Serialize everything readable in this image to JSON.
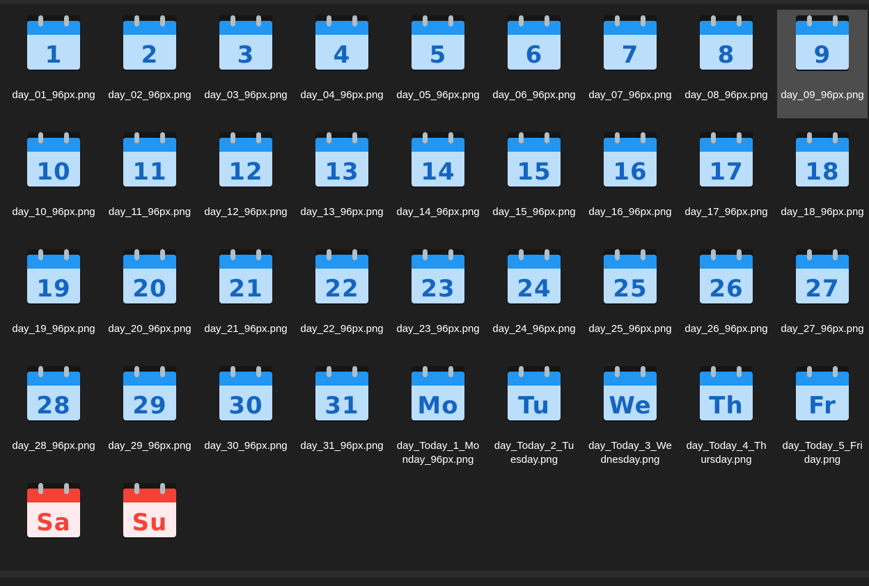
{
  "files": [
    {
      "day": "1",
      "name": "day_01_96px.png",
      "selected": false,
      "color": "blue"
    },
    {
      "day": "2",
      "name": "day_02_96px.png",
      "selected": false,
      "color": "blue"
    },
    {
      "day": "3",
      "name": "day_03_96px.png",
      "selected": false,
      "color": "blue"
    },
    {
      "day": "4",
      "name": "day_04_96px.png",
      "selected": false,
      "color": "blue"
    },
    {
      "day": "5",
      "name": "day_05_96px.png",
      "selected": false,
      "color": "blue"
    },
    {
      "day": "6",
      "name": "day_06_96px.png",
      "selected": false,
      "color": "blue"
    },
    {
      "day": "7",
      "name": "day_07_96px.png",
      "selected": false,
      "color": "blue"
    },
    {
      "day": "8",
      "name": "day_08_96px.png",
      "selected": false,
      "color": "blue"
    },
    {
      "day": "9",
      "name": "day_09_96px.png",
      "selected": true,
      "color": "blue"
    },
    {
      "day": "10",
      "name": "day_10_96px.png",
      "selected": false,
      "color": "blue"
    },
    {
      "day": "11",
      "name": "day_11_96px.png",
      "selected": false,
      "color": "blue"
    },
    {
      "day": "12",
      "name": "day_12_96px.png",
      "selected": false,
      "color": "blue"
    },
    {
      "day": "13",
      "name": "day_13_96px.png",
      "selected": false,
      "color": "blue"
    },
    {
      "day": "14",
      "name": "day_14_96px.png",
      "selected": false,
      "color": "blue"
    },
    {
      "day": "15",
      "name": "day_15_96px.png",
      "selected": false,
      "color": "blue"
    },
    {
      "day": "16",
      "name": "day_16_96px.png",
      "selected": false,
      "color": "blue"
    },
    {
      "day": "17",
      "name": "day_17_96px.png",
      "selected": false,
      "color": "blue"
    },
    {
      "day": "18",
      "name": "day_18_96px.png",
      "selected": false,
      "color": "blue"
    },
    {
      "day": "19",
      "name": "day_19_96px.png",
      "selected": false,
      "color": "blue"
    },
    {
      "day": "20",
      "name": "day_20_96px.png",
      "selected": false,
      "color": "blue"
    },
    {
      "day": "21",
      "name": "day_21_96px.png",
      "selected": false,
      "color": "blue"
    },
    {
      "day": "22",
      "name": "day_22_96px.png",
      "selected": false,
      "color": "blue"
    },
    {
      "day": "23",
      "name": "day_23_96px.png",
      "selected": false,
      "color": "blue"
    },
    {
      "day": "24",
      "name": "day_24_96px.png",
      "selected": false,
      "color": "blue"
    },
    {
      "day": "25",
      "name": "day_25_96px.png",
      "selected": false,
      "color": "blue"
    },
    {
      "day": "26",
      "name": "day_26_96px.png",
      "selected": false,
      "color": "blue"
    },
    {
      "day": "27",
      "name": "day_27_96px.png",
      "selected": false,
      "color": "blue"
    },
    {
      "day": "28",
      "name": "day_28_96px.png",
      "selected": false,
      "color": "blue"
    },
    {
      "day": "29",
      "name": "day_29_96px.png",
      "selected": false,
      "color": "blue"
    },
    {
      "day": "30",
      "name": "day_30_96px.png",
      "selected": false,
      "color": "blue"
    },
    {
      "day": "31",
      "name": "day_31_96px.png",
      "selected": false,
      "color": "blue"
    },
    {
      "day": "Mo",
      "name": "day_Today_1_Monday_96px.png",
      "selected": false,
      "color": "blue"
    },
    {
      "day": "Tu",
      "name": "day_Today_2_Tuesday.png",
      "selected": false,
      "color": "blue"
    },
    {
      "day": "We",
      "name": "day_Today_3_Wednesday.png",
      "selected": false,
      "color": "blue"
    },
    {
      "day": "Th",
      "name": "day_Today_4_Thursday.png",
      "selected": false,
      "color": "blue"
    },
    {
      "day": "Fr",
      "name": "day_Today_5_Friday.png",
      "selected": false,
      "color": "blue"
    },
    {
      "day": "Sa",
      "name": "",
      "selected": false,
      "color": "red"
    },
    {
      "day": "Su",
      "name": "",
      "selected": false,
      "color": "red"
    }
  ],
  "colors": {
    "background": "#1f1f1f",
    "selection": "#4d4d4d",
    "calendar_head_blue": "#2196f3",
    "calendar_body_blue": "#bbdefb",
    "calendar_text_blue": "#1565c0",
    "calendar_head_red": "#f44336",
    "calendar_body_red": "#ffebee",
    "calendar_text_red": "#f44336",
    "calendar_ring": "#b0bec5"
  },
  "icon": "calendar-icon",
  "status": {
    "text": ""
  }
}
